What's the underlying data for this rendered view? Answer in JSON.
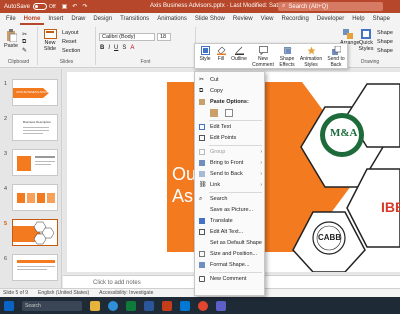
{
  "titlebar": {
    "autosave": "AutoSave",
    "toggle": "Off",
    "doc_title": "Axis Business Advisors.pptx  ·  Last Modified: Sat at 6:00 pm",
    "search": "Search (Alt+Q)"
  },
  "tabs": [
    "File",
    "Home",
    "Insert",
    "Draw",
    "Design",
    "Transitions",
    "Animations",
    "Slide Show",
    "Review",
    "View",
    "Recording",
    "Developer",
    "Help",
    "Shape"
  ],
  "ribbon": {
    "paste": "Paste",
    "clipboard_label": "Clipboard",
    "new_slide": "New Slide",
    "layout": "Layout",
    "reset": "Reset",
    "section": "Section",
    "slides_label": "Slides",
    "font_name": "Calibri (Body)",
    "font_size": "18",
    "font_label": "Font",
    "arrange": "Arrange",
    "quick_styles": "Quick Styles",
    "drawing_label": "Drawing",
    "shape_fill": "Shape",
    "shape_outline": "Shape",
    "shape_effects": "Shape"
  },
  "minibar": {
    "style": "Style",
    "fill": "Fill",
    "outline": "Outline",
    "new_comment": "New Comment",
    "shape_effects": "Shape Effects",
    "animation_styles": "Animation Styles",
    "send_to_back": "Send to Back"
  },
  "context_menu": {
    "cut": "Cut",
    "copy": "Copy",
    "paste_options": "Paste Options:",
    "edit_text": "Edit Text",
    "edit_points": "Edit Points",
    "group": "Group",
    "bring_to_front": "Bring to Front",
    "send_to_back": "Send to Back",
    "link": "Link",
    "search": "Search",
    "save_as_picture": "Save as Picture...",
    "translate": "Translate",
    "edit_alt_text": "Edit Alt Text...",
    "set_default_shape": "Set as Default Shape",
    "size_position": "Size and Position...",
    "format_shape": "Format Shape...",
    "new_comment": "New Comment"
  },
  "slide": {
    "title_line1": "Ou",
    "title_line2": "As",
    "logo_text": "M&A",
    "cabb_text": "CABB",
    "ibe_text": "IBE"
  },
  "thumbnails": {
    "numbers": [
      "1",
      "2",
      "3",
      "4",
      "5",
      "6"
    ],
    "slide1_text": "AXIS BUSINESS ADVISORS",
    "slide2_text": "Business Description"
  },
  "notes": "Click to add notes",
  "status": {
    "slide_count": "Slide 5 of 9",
    "language": "English (United States)",
    "accessibility": "Accessibility: Investigate"
  },
  "taskbar": {
    "search": "Search"
  },
  "colors": {
    "brand": "#b7472a",
    "orange": "#f47a20",
    "green": "#1d6b3a",
    "red": "#d63a2a"
  }
}
